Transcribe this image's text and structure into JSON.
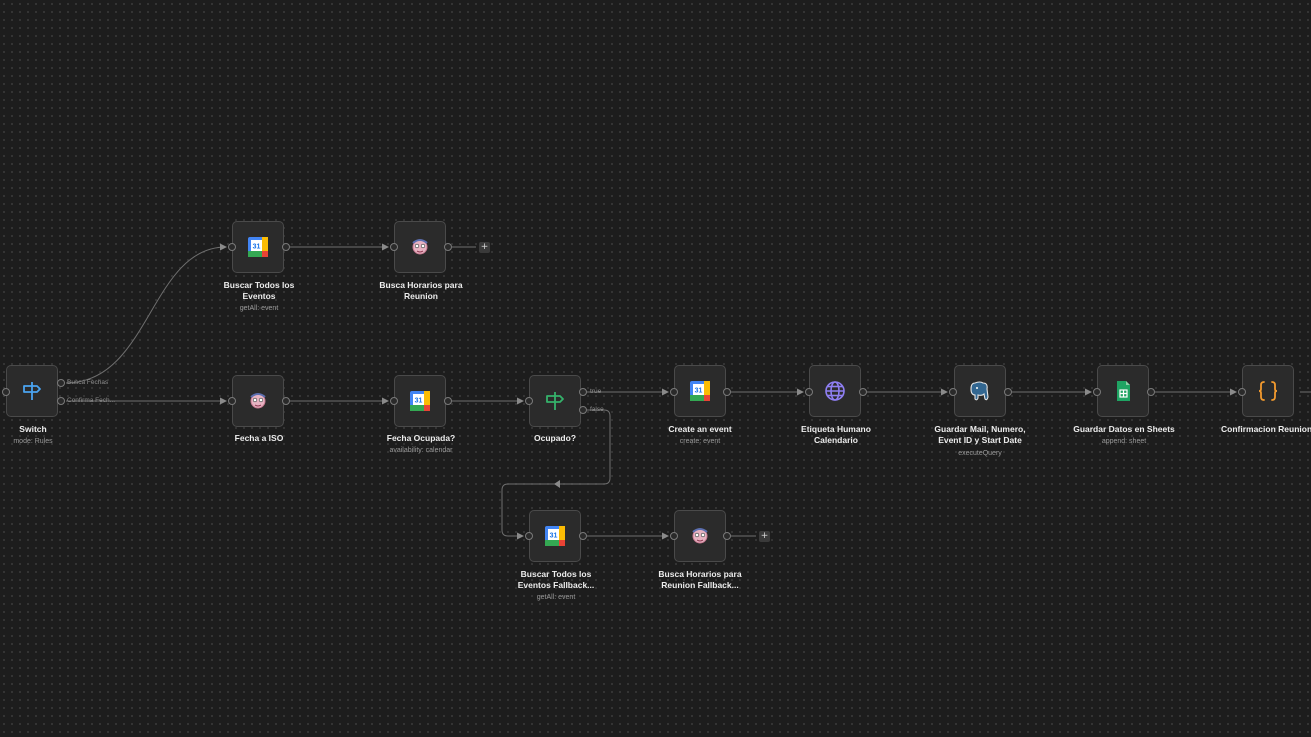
{
  "nodes": {
    "switch": {
      "title": "Switch",
      "subtitle": "mode: Rules",
      "icon": "signpost-icon",
      "out_1": "Busca Fechas",
      "out_2": "Confirma Fech..."
    },
    "buscar_todos": {
      "title": "Buscar Todos los Eventos",
      "subtitle": "getAll: event",
      "icon": "google-calendar-icon"
    },
    "busca_horarios": {
      "title": "Busca Horarios para Reunion",
      "icon": "agent-robot-icon"
    },
    "fecha_iso": {
      "title": "Fecha a ISO",
      "icon": "agent-robot-icon"
    },
    "fecha_ocupada": {
      "title": "Fecha Ocupada?",
      "subtitle": "availability: calendar",
      "icon": "google-calendar-icon"
    },
    "ocupado": {
      "title": "Ocupado?",
      "icon": "signpost-icon",
      "out_true": "true",
      "out_false": "false"
    },
    "create_event": {
      "title": "Create an event",
      "subtitle": "create: event",
      "icon": "google-calendar-icon"
    },
    "etiqueta": {
      "title": "Etiqueta Humano Calendario",
      "icon": "globe-icon"
    },
    "guardar_mail": {
      "title": "Guardar Mail, Numero, Event ID y Start Date",
      "subtitle": "executeQuery",
      "icon": "postgres-elephant-icon"
    },
    "guardar_sheets": {
      "title": "Guardar Datos en Sheets",
      "subtitle": "append: sheet",
      "icon": "google-sheets-icon"
    },
    "confirmacion": {
      "title": "Confirmacion Reunion",
      "icon": "code-braces-icon"
    },
    "buscar_fallback": {
      "title": "Buscar Todos los Eventos Fallback...",
      "subtitle": "getAll: event",
      "icon": "google-calendar-icon"
    },
    "busca_horarios_fallback": {
      "title": "Busca Horarios para Reunion Fallback...",
      "icon": "agent-robot-icon"
    }
  },
  "calendar_day": "31",
  "add_button_label": "+",
  "colors": {
    "canvas_bg": "#1d1d1d",
    "node_bg": "#2b2b2b",
    "wire": "#6e6e6e",
    "switch_icon": "#4aa3f0",
    "if_icon": "#35b26b",
    "globe_icon": "#8f7ff2",
    "code_icon": "#f29a2e",
    "sheets_green": "#1fa463",
    "gcal_blue": "#4285f4"
  }
}
